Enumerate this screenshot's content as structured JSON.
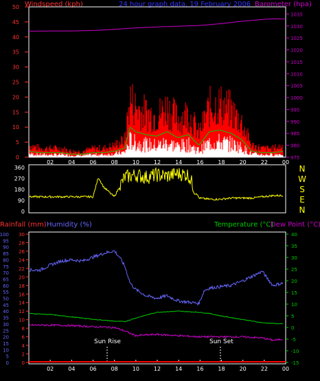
{
  "header": {
    "left": "Windspeed (kph)",
    "center": "24 hour graph data, 19 February 2006",
    "right": "Barometer (hpa)"
  },
  "colors": {
    "wind_max": "#ff0000",
    "wind_avg": "#00cc00",
    "wind_min": "#ffffff",
    "baro": "#cc00cc",
    "dir": "#ffff00",
    "humidity": "#6666ff",
    "temperature": "#00cc00",
    "dewpoint": "#cc00cc",
    "rain": "#ff0000",
    "axis_left": "#ff3333",
    "axis_blue": "#6666ff",
    "axis_green": "#00cc00",
    "axis_mag": "#cc00cc",
    "frame": "#ffffff"
  },
  "bottom_labels": {
    "rain": "Rainfall (mm)",
    "humidity": "Humidity (%)",
    "temperature": "Temperature (°C)",
    "dewpoint": "Dew Point (°C)"
  },
  "annotations": {
    "sunrise": "Sun Rise",
    "sunset": "Sun Set"
  },
  "chart_data": [
    {
      "type": "area",
      "x_ticks": [
        "02",
        "04",
        "06",
        "08",
        "10",
        "12",
        "14",
        "16",
        "18",
        "20",
        "22",
        "00"
      ],
      "xlim": [
        0,
        24
      ],
      "wind_axis": {
        "ticks": [
          0,
          5,
          10,
          15,
          20,
          25,
          30,
          35,
          40,
          45,
          50
        ],
        "ylim": [
          0,
          50
        ]
      },
      "baro_axis": {
        "ticks": [
          975,
          980,
          985,
          990,
          995,
          1000,
          1005,
          1010,
          1015,
          1020,
          1025,
          1030,
          1035
        ],
        "ylim": [
          975,
          1038
        ]
      },
      "series": [
        {
          "name": "Barometer (hpa)",
          "x": [
            0,
            2,
            4,
            6,
            8,
            10,
            12,
            14,
            16,
            18,
            20,
            22,
            23,
            24
          ],
          "values": [
            1027.8,
            1027.9,
            1027.9,
            1028.1,
            1028.6,
            1029.2,
            1029.6,
            1029.9,
            1030.2,
            1031.0,
            1032.0,
            1032.8,
            1033.0,
            1032.9
          ]
        },
        {
          "name": "Windspeed (kph)",
          "x": [
            0,
            1,
            2,
            3,
            4,
            5,
            6,
            7,
            8,
            9,
            9.5,
            10,
            11,
            12,
            13,
            14,
            15,
            16,
            17,
            18,
            19,
            20,
            21,
            22,
            23,
            24
          ],
          "values": [
            4,
            3,
            3,
            3,
            2,
            2,
            3,
            3,
            4,
            6,
            20,
            17,
            15,
            14,
            17,
            13,
            15,
            8,
            17,
            18,
            16,
            12,
            4,
            3,
            3,
            4
          ]
        }
      ]
    },
    {
      "type": "line",
      "compass_labels": [
        "N",
        "W",
        "S",
        "E",
        "N"
      ],
      "y_ticks": [
        0,
        90,
        180,
        270,
        360
      ],
      "ylim": [
        0,
        360
      ],
      "series": [
        {
          "name": "Wind direction",
          "x": [
            0,
            1,
            2,
            3,
            4,
            5,
            6,
            6.5,
            7,
            8,
            8.5,
            9,
            10,
            11,
            12,
            13,
            14,
            15,
            15.5,
            16,
            17,
            18,
            19,
            20,
            21,
            22,
            23,
            24
          ],
          "values": [
            120,
            120,
            120,
            120,
            120,
            120,
            120,
            280,
            200,
            120,
            200,
            280,
            300,
            280,
            300,
            290,
            310,
            300,
            200,
            110,
            100,
            100,
            110,
            110,
            110,
            120,
            130,
            130
          ]
        }
      ]
    },
    {
      "type": "line",
      "rain_axis": {
        "ticks": [
          0,
          5,
          10,
          15,
          20,
          25,
          30,
          35,
          40,
          45,
          50,
          55,
          60,
          65,
          70,
          75,
          80,
          85,
          90,
          95,
          100
        ],
        "ylim": [
          0,
          100
        ]
      },
      "humidity_axis": {
        "ticks": [
          0,
          2,
          4,
          6,
          8,
          10,
          12,
          14,
          16,
          18,
          20,
          22,
          24,
          26,
          28,
          30
        ],
        "ylim": [
          0,
          30
        ]
      },
      "temp_axis": {
        "ticks": [
          -15,
          -10,
          -5,
          0,
          5,
          10,
          15,
          20,
          25,
          30,
          35,
          40
        ],
        "ylim": [
          -15,
          40
        ]
      },
      "series": [
        {
          "name": "Humidity (%)",
          "x": [
            0,
            1,
            2,
            3,
            4,
            5,
            6,
            7,
            8,
            8.5,
            9,
            9.5,
            10,
            11,
            12,
            13,
            14,
            15,
            16,
            16.5,
            17,
            18,
            19,
            20,
            21,
            22,
            22.5,
            23,
            24
          ],
          "values": [
            72,
            72,
            76,
            79,
            80,
            79,
            82,
            85,
            87,
            82,
            75,
            62,
            57,
            52,
            50,
            52,
            48,
            47,
            46,
            56,
            58,
            59,
            60,
            63,
            67,
            71,
            65,
            60,
            62
          ]
        },
        {
          "name": "Temperature (°C)",
          "x": [
            0,
            2,
            4,
            6,
            8,
            9,
            10,
            12,
            14,
            16,
            17,
            18,
            20,
            22,
            24
          ],
          "values": [
            6.0,
            5.5,
            4.5,
            3.5,
            2.7,
            2.5,
            4.0,
            6.5,
            7.0,
            6.5,
            6.0,
            5.0,
            3.5,
            2.0,
            1.5
          ]
        },
        {
          "name": "Dew Point (°C)",
          "x": [
            0,
            2,
            4,
            6,
            8,
            9,
            10,
            12,
            14,
            16,
            18,
            20,
            22,
            23,
            24
          ],
          "values": [
            1.0,
            1.0,
            0.8,
            0.3,
            0.0,
            -1.5,
            -3.5,
            -3.0,
            -3.5,
            -4.0,
            -4.0,
            -4.0,
            -4.5,
            -5.5,
            -5.0
          ]
        },
        {
          "name": "Rainfall (mm)",
          "x": [
            0,
            24
          ],
          "values": [
            0,
            0
          ]
        }
      ]
    }
  ]
}
